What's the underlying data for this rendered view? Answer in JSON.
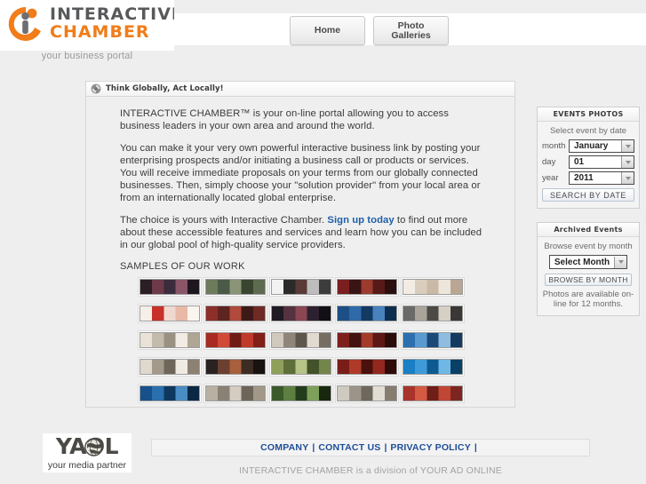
{
  "site": {
    "logo_line1": "INTERACTIVE",
    "logo_line2": "CHAMBER",
    "tagline": "your business portal"
  },
  "nav": {
    "items": [
      {
        "label": "Home"
      },
      {
        "label": "Photo\nGalleries"
      }
    ]
  },
  "main": {
    "panel_title": "Think Globally, Act Locally!",
    "panel_icon": "globe-swirl-icon",
    "paragraphs": [
      "INTERACTIVE CHAMBER™ is your on-line portal allowing you to access business leaders in your own area and around the world.",
      "You can make it your very own powerful interactive business link by posting your enterprising prospects and/or initiating a business call or products or services. You will receive immediate proposals on your terms from our globally connected businesses. Then, simply choose your \"solution provider\" from your local area or from an internationally located global enterprise."
    ],
    "choice_prefix": "The choice is yours with Interactive Chamber. ",
    "signup_link": "Sign up today",
    "choice_suffix": " to find out more about these accessible features and services and learn how you can be included in our global pool of high-quality service providers.",
    "samples_label": "SAMPLES OF OUR WORK",
    "thumbnails": [
      {
        "id": 1,
        "alt": "event collage 1",
        "colors": [
          "#2a1f26",
          "#6d3a4a",
          "#3a2b3d",
          "#8a5566",
          "#1d1720"
        ]
      },
      {
        "id": 2,
        "alt": "event collage 2",
        "colors": [
          "#6d7a5c",
          "#4a5a46",
          "#8c9478",
          "#39452f",
          "#5e6b50"
        ]
      },
      {
        "id": 3,
        "alt": "event collage 3",
        "colors": [
          "#f2f2f2",
          "#2a2a2a",
          "#5a3a36",
          "#bdbdbd",
          "#3c3c3c"
        ]
      },
      {
        "id": 4,
        "alt": "event collage 4",
        "colors": [
          "#7a1f1f",
          "#3a1414",
          "#9c3b2e",
          "#571a18",
          "#2b0f0f"
        ]
      },
      {
        "id": 5,
        "alt": "event collage 5",
        "colors": [
          "#f3ece4",
          "#d9cdbe",
          "#c9b9a6",
          "#eee6db",
          "#b9a794"
        ]
      },
      {
        "id": 6,
        "alt": "event collage 6",
        "colors": [
          "#f6efe8",
          "#c8302a",
          "#f0d8cf",
          "#e8b9a6",
          "#fbf5ef"
        ]
      },
      {
        "id": 7,
        "alt": "event collage 7",
        "colors": [
          "#8c2f2a",
          "#5e2420",
          "#b04a3c",
          "#3d1a17",
          "#6f2a25"
        ]
      },
      {
        "id": 8,
        "alt": "event collage 8",
        "colors": [
          "#201a24",
          "#55323f",
          "#8a4652",
          "#2d2130",
          "#130f16"
        ]
      },
      {
        "id": 9,
        "alt": "event collage 9",
        "colors": [
          "#1d4f86",
          "#2f6aa8",
          "#123a63",
          "#4a82bd",
          "#0e2e50"
        ]
      },
      {
        "id": 10,
        "alt": "event collage 10",
        "colors": [
          "#6a6a68",
          "#a9a39a",
          "#4c4a46",
          "#d6cfc4",
          "#3a3836"
        ]
      },
      {
        "id": 11,
        "alt": "event collage 11",
        "colors": [
          "#e8e2d8",
          "#c3bbac",
          "#9a9183",
          "#f0ece3",
          "#b0a695"
        ]
      },
      {
        "id": 12,
        "alt": "event collage 12",
        "colors": [
          "#a82a22",
          "#d04a38",
          "#6f1a15",
          "#c03a2c",
          "#821f19"
        ]
      },
      {
        "id": 13,
        "alt": "event collage 13",
        "colors": [
          "#cfc8bd",
          "#8f8679",
          "#5c564c",
          "#e0dad0",
          "#766e62"
        ]
      },
      {
        "id": 14,
        "alt": "event collage 14",
        "colors": [
          "#7e1f1c",
          "#421110",
          "#a33a2c",
          "#5d1714",
          "#2c0c0b"
        ]
      },
      {
        "id": 15,
        "alt": "event collage 15",
        "colors": [
          "#2d6fae",
          "#5a9ad0",
          "#1b4a78",
          "#8fbce0",
          "#143a60"
        ]
      },
      {
        "id": 16,
        "alt": "event collage 16",
        "colors": [
          "#ded8cd",
          "#a39a8c",
          "#6e665a",
          "#f0ebe2",
          "#8b8274"
        ]
      },
      {
        "id": 17,
        "alt": "event collage 17",
        "colors": [
          "#2a2220",
          "#6a4030",
          "#a85f3c",
          "#3c2c24",
          "#181211"
        ]
      },
      {
        "id": 18,
        "alt": "event collage 18",
        "colors": [
          "#8fa05c",
          "#5e6f3a",
          "#b6c487",
          "#44522a",
          "#73854a"
        ]
      },
      {
        "id": 19,
        "alt": "event collage 19",
        "colors": [
          "#7a1d19",
          "#b03a2a",
          "#4a100e",
          "#92281f",
          "#2e0a09"
        ]
      },
      {
        "id": 20,
        "alt": "event collage 20",
        "colors": [
          "#1a7fc4",
          "#3f9bd8",
          "#0e5a90",
          "#6fb8e6",
          "#0a3f66"
        ]
      },
      {
        "id": 21,
        "alt": "event collage 21",
        "colors": [
          "#17508a",
          "#2a6fae",
          "#0e3860",
          "#4a8cc4",
          "#0a2844"
        ]
      },
      {
        "id": 22,
        "alt": "event collage 22",
        "colors": [
          "#b8b0a2",
          "#8a8174",
          "#d4ccc0",
          "#6d6559",
          "#a29888"
        ]
      },
      {
        "id": 23,
        "alt": "event collage 23",
        "colors": [
          "#3a5a2c",
          "#5e7f42",
          "#243c1c",
          "#7ea05a",
          "#17280f"
        ]
      },
      {
        "id": 24,
        "alt": "event collage 24",
        "colors": [
          "#cfcac0",
          "#9c9488",
          "#6e675c",
          "#e2ddd4",
          "#857d70"
        ]
      },
      {
        "id": 25,
        "alt": "event collage 25",
        "colors": [
          "#a8332a",
          "#d45a44",
          "#6f1e18",
          "#c04636",
          "#7d2620"
        ]
      }
    ]
  },
  "sidebar": {
    "events_panel": {
      "title": "EVENTS PHOTOS",
      "subtitle": "Select event by date",
      "fields": [
        {
          "label": "month",
          "value": "January"
        },
        {
          "label": "day",
          "value": "01"
        },
        {
          "label": "year",
          "value": "2011"
        }
      ],
      "button_label": "SEARCH BY DATE"
    },
    "archived_panel": {
      "title": "Archived Events",
      "subtitle": "Browse event by month",
      "select_value": "Select Month",
      "button_label": "BROWSE BY MONTH",
      "note": "Photos are available\non-line for 12 months."
    }
  },
  "footer": {
    "yaol_text": "YAOL",
    "yaol_tagline": "your media partner",
    "links": [
      {
        "label": "COMPANY"
      },
      {
        "label": "CONTACT US"
      },
      {
        "label": "PRIVACY POLICY"
      }
    ],
    "separator": "|",
    "note": "INTERACTIVE CHAMBER is a division of YOUR AD ONLINE"
  },
  "colors": {
    "accent_orange": "#f07d1a",
    "link_blue": "#1f4e96",
    "page_bg": "#eeeeee"
  }
}
